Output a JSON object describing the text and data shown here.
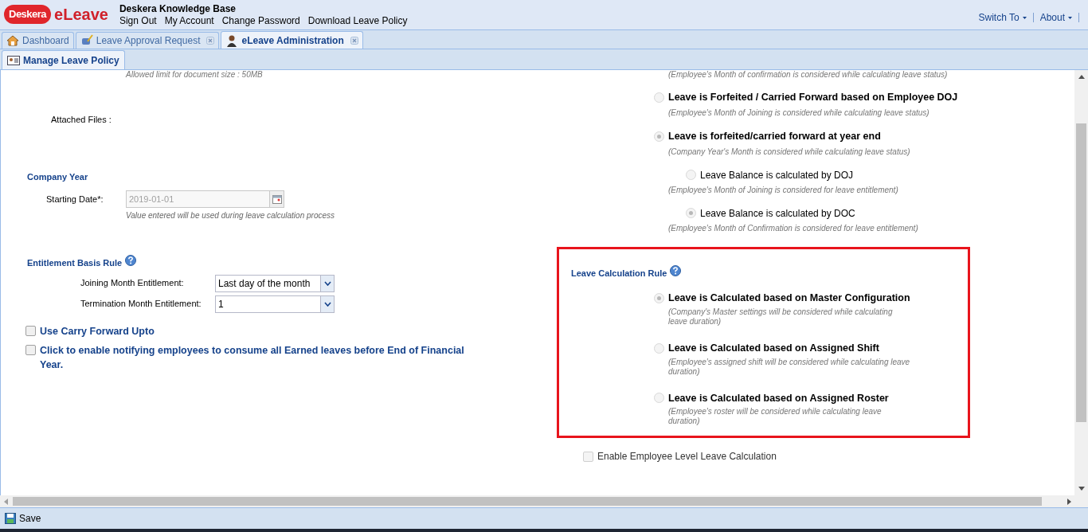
{
  "header": {
    "logo": "Deskera",
    "app_name": "eLeave",
    "title": "Deskera Knowledge Base",
    "links": [
      "Sign Out",
      "My Account",
      "Change Password",
      "Download Leave Policy"
    ],
    "menus": [
      "Switch To",
      "About"
    ]
  },
  "tabs": [
    {
      "label": "Dashboard",
      "selected": false,
      "closable": false,
      "kind": "house"
    },
    {
      "label": "Leave Approval Request",
      "selected": false,
      "closable": true,
      "kind": "pen"
    },
    {
      "label": "eLeave Administration",
      "selected": true,
      "closable": true,
      "kind": "person"
    }
  ],
  "subtabs": [
    {
      "label": "Manage Leave Policy",
      "selected": true
    }
  ],
  "left": {
    "upload_note": "Allowed limit for document size : 50MB",
    "attached_files_label": "Attached Files :",
    "company_year": {
      "heading": "Company Year",
      "label": "Starting Date*:",
      "value": "2019-01-01",
      "hint": "Value entered will be used during leave calculation process"
    },
    "entitlement": {
      "heading": "Entitlement Basis Rule",
      "fields": [
        {
          "label": "Joining Month Entitlement:",
          "value": "Last day of the month"
        },
        {
          "label": "Termination Month Entitlement:",
          "value": "1"
        }
      ]
    },
    "checkboxes": [
      {
        "label": "Use Carry Forward Upto",
        "checked": false
      },
      {
        "label": "Click to enable notifying employees to consume all Earned leaves before End of Financial Year.",
        "checked": false
      }
    ]
  },
  "right": {
    "top_note": "(Employee's Month of confirmation is considered while calculating leave status)",
    "status_options": [
      {
        "label": "Leave is Forfeited / Carried Forward based on Employee DOJ",
        "note": "(Employee's Month of Joining is considered while calculating leave status)",
        "selected": false
      },
      {
        "label": "Leave is forfeited/carried forward at year end",
        "note": "(Company Year's Month is considered while calculating leave status)",
        "selected": true,
        "children": [
          {
            "label": "Leave Balance is calculated by DOJ",
            "note": "(Employee's Month of Joining is considered for leave entitlement)",
            "selected": false
          },
          {
            "label": "Leave Balance is calculated by DOC",
            "note": "(Employee's Month of Confirmation is considered for leave entitlement)",
            "selected": true
          }
        ]
      }
    ],
    "calc_rule": {
      "heading": "Leave Calculation Rule",
      "highlighted": true,
      "options": [
        {
          "label": "Leave is Calculated based on Master Configuration",
          "note": "(Company's Master settings will be considered while calculating leave duration)",
          "selected": true
        },
        {
          "label": "Leave is Calculated based on Assigned Shift",
          "note": "(Employee's assigned shift will be considered while calculating leave duration)",
          "selected": false
        },
        {
          "label": "Leave is Calculated based on Assigned Roster",
          "note": "(Employee's roster will be considered while calculating leave duration)",
          "selected": false
        }
      ]
    },
    "employee_level": {
      "label": "Enable Employee Level Leave Calculation",
      "checked": false,
      "disabled": true
    }
  },
  "toolbar": {
    "save": "Save"
  }
}
